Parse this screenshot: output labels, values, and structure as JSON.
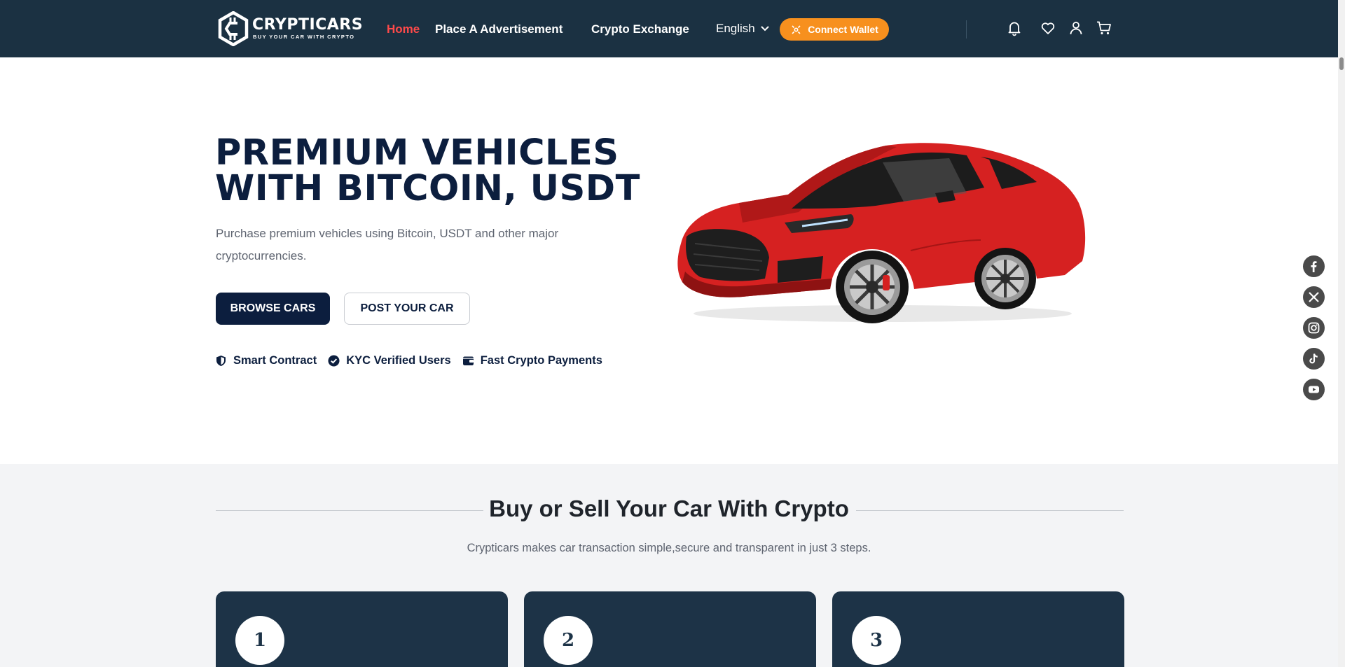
{
  "brand": {
    "name": "CRYPTICARS",
    "tagline": "BUY YOUR CAR WITH CRYPTO"
  },
  "nav": {
    "links": [
      {
        "label": "Home",
        "active": true
      },
      {
        "label": "Place A Advertisement",
        "active": false
      },
      {
        "label": "Crypto Exchange",
        "active": false
      }
    ],
    "language": "English",
    "connect_wallet": "Connect Wallet",
    "icons": [
      "bell-icon",
      "heart-icon",
      "user-icon",
      "cart-icon"
    ]
  },
  "hero": {
    "title_line1": "PREMIUM VEHICLES",
    "title_line2": "WITH BITCOIN, USDT",
    "description": "Purchase premium vehicles using Bitcoin, USDT and other major cryptocurrencies.",
    "primary_button": "BROWSE CARS",
    "secondary_button": "POST YOUR CAR",
    "features": [
      {
        "icon": "shield-icon",
        "label": "Smart Contract"
      },
      {
        "icon": "check-badge-icon",
        "label": "KYC Verified Users"
      },
      {
        "icon": "wallet-icon",
        "label": "Fast Crypto Payments"
      }
    ]
  },
  "social": [
    "facebook-icon",
    "x-twitter-icon",
    "instagram-icon",
    "tiktok-icon",
    "youtube-icon"
  ],
  "how_it_works": {
    "title": "Buy or Sell Your Car With Crypto",
    "subtitle": "Crypticars makes car transaction simple,secure and transparent in just 3 steps.",
    "steps": [
      {
        "number": "1"
      },
      {
        "number": "2"
      },
      {
        "number": "3"
      }
    ]
  },
  "colors": {
    "navbar": "#1b3142",
    "accent_orange": "#f7901e",
    "active_link": "#ff4a4a",
    "primary_dark": "#0c1e3e",
    "section_bg": "#f3f4f6",
    "card_bg": "#1d3347"
  }
}
